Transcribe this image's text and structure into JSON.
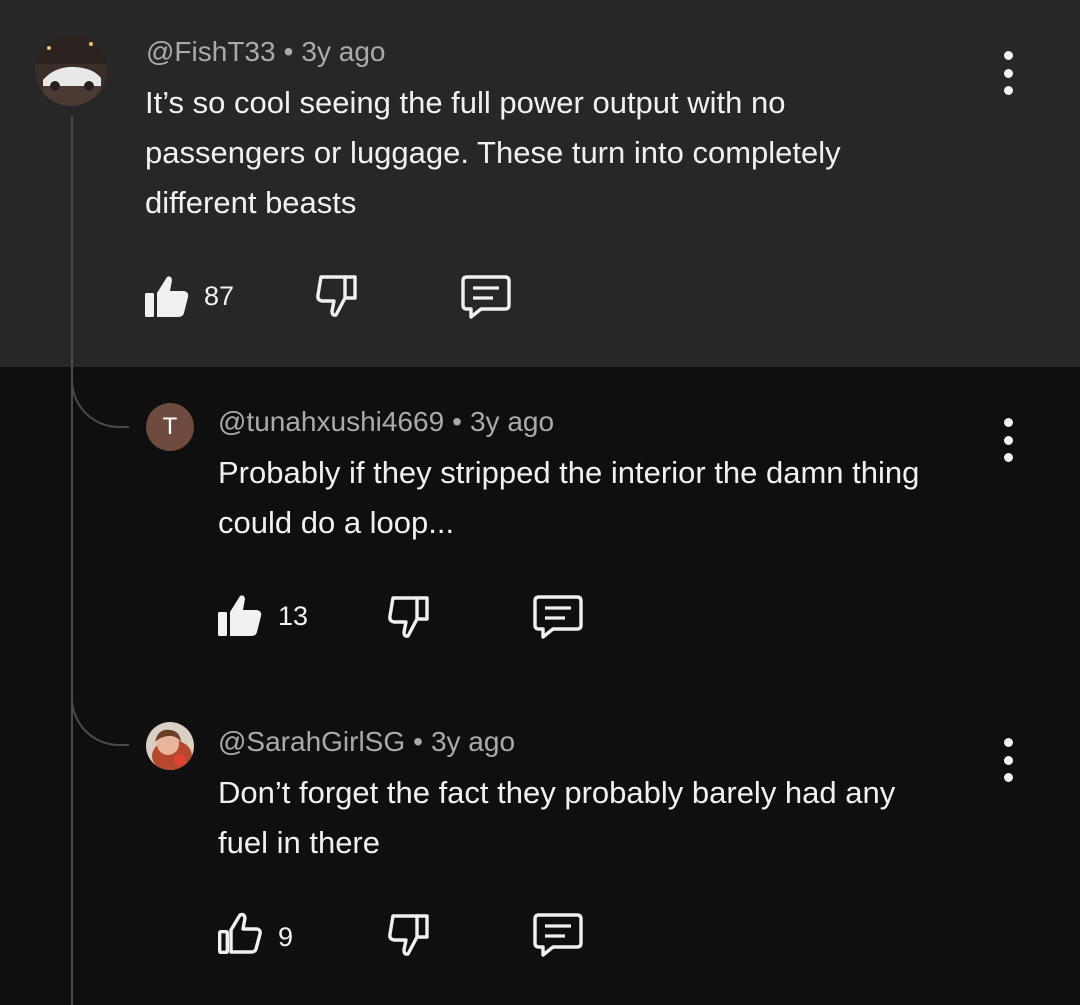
{
  "comments": [
    {
      "handle": "@FishT33",
      "time": "3y ago",
      "text_lines": [
        "It’s so cool seeing the full power output with no",
        "passengers or luggage. These turn into completely",
        "different beasts"
      ],
      "likes": "87",
      "liked": true,
      "avatar": "car-photo-icon"
    },
    {
      "handle": "@tunahxushi4669",
      "time": "3y ago",
      "text_lines": [
        "Probably if they stripped the interior the damn thing",
        "could do a loop..."
      ],
      "likes": "13",
      "liked": true,
      "avatar_letter": "T",
      "avatar_color": "#6f4a3e"
    },
    {
      "handle": "@SarahGirlSG",
      "time": "3y ago",
      "text_lines": [
        "Don’t forget the fact they probably barely had any",
        "fuel in there"
      ],
      "likes": "9",
      "liked": false,
      "avatar": "person-photo-icon"
    }
  ],
  "separator": "•",
  "colors": {
    "top_comment_bg": "#272727",
    "page_bg": "#0f0f0f",
    "meta_text": "#aaaaaa",
    "body_text": "#f1f1f1"
  }
}
